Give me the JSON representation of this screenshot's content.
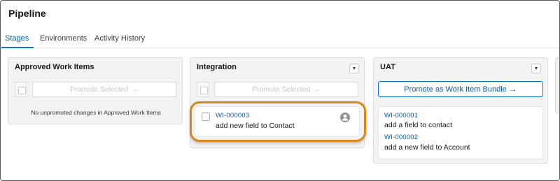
{
  "page": {
    "title": "Pipeline"
  },
  "tabs": [
    {
      "label": "Stages",
      "active": true
    },
    {
      "label": "Environments",
      "active": false
    },
    {
      "label": "Activity History",
      "active": false
    }
  ],
  "columns": {
    "approved": {
      "title": "Approved Work Items",
      "promote_label": "Promote Selected",
      "empty_message": "No unpromoted changes in Approved Work Items"
    },
    "integration": {
      "title": "Integration",
      "promote_label": "Promote Selected",
      "items": [
        {
          "id": "WI-000003",
          "title": "add new field to Contact"
        }
      ]
    },
    "uat": {
      "title": "UAT",
      "promote_label": "Promote as Work Item Bundle",
      "items": [
        {
          "id": "WI-000001",
          "title": "add a field to contact"
        },
        {
          "id": "WI-000002",
          "title": "add a new field to Account"
        }
      ]
    }
  },
  "icons": {
    "arrow": "→",
    "menu": "▼"
  },
  "colors": {
    "brand_blue": "#0176d3",
    "link_blue": "#0b5cab",
    "highlight": "#d6891a"
  }
}
